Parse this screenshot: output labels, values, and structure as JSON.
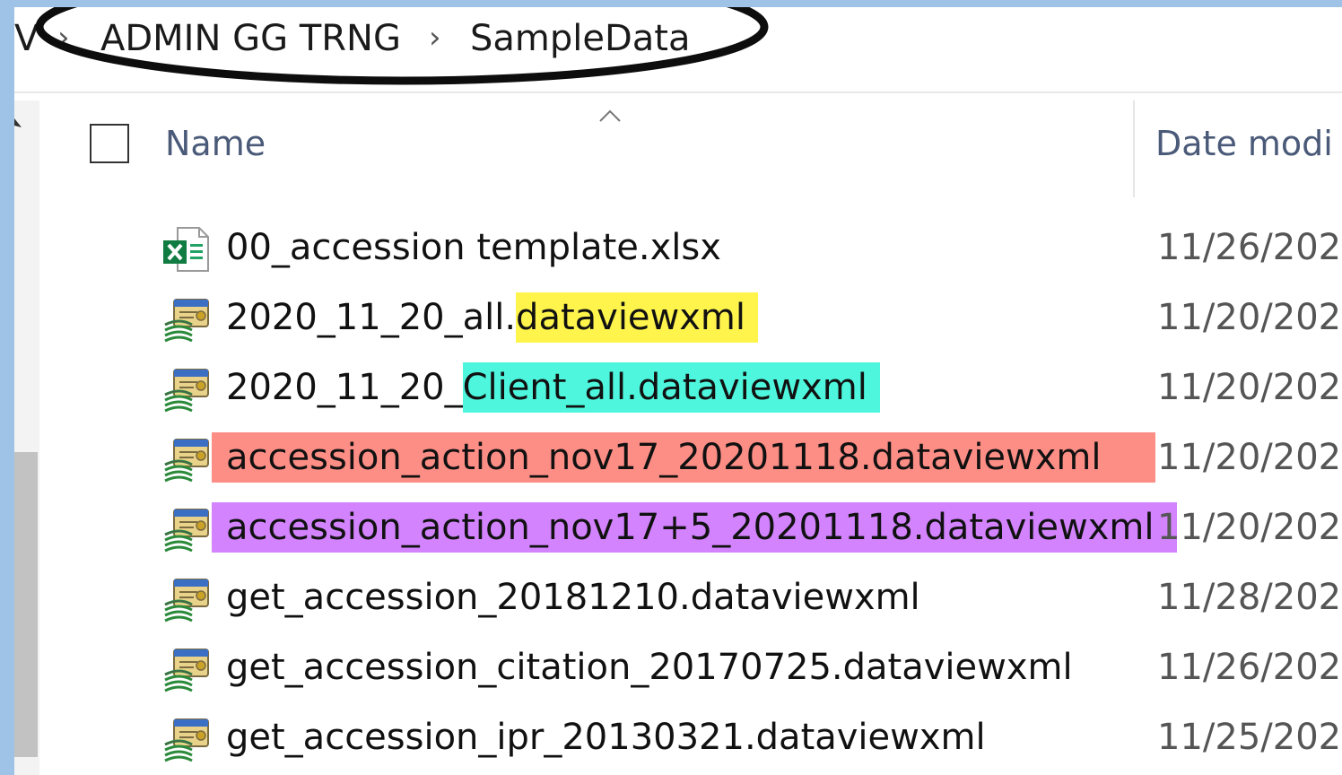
{
  "breadcrumb": {
    "partial_left": "V",
    "items": [
      "ADMIN GG TRNG",
      "SampleData"
    ]
  },
  "columns": {
    "name": "Name",
    "date_modified": "Date modi"
  },
  "highlight_colors": {
    "yellow": "#fef44c",
    "cyan": "#4df6dc",
    "salmon": "#fd8e86",
    "purple": "#d283fd"
  },
  "files": [
    {
      "icon": "excel-icon",
      "name_pre": "00_accession template.xlsx",
      "name_hl": "",
      "name_post": "",
      "highlight": "none",
      "date": "11/26/202"
    },
    {
      "icon": "dataview-xml-icon",
      "name_pre": "2020_11_20_all.",
      "name_hl": "dataviewxml",
      "name_post": "",
      "highlight": "yellow",
      "date": "11/20/202"
    },
    {
      "icon": "dataview-xml-icon",
      "name_pre": "2020_11_20_",
      "name_hl": "Client_all.dataviewxml",
      "name_post": "",
      "highlight": "cyan",
      "date": "11/20/202"
    },
    {
      "icon": "dataview-xml-icon",
      "name_pre": "",
      "name_hl": "accession_action_nov17_20201118.dataviewxml",
      "name_post": "",
      "highlight": "salmon",
      "date": "11/20/202"
    },
    {
      "icon": "dataview-xml-icon",
      "name_pre": "",
      "name_hl": "accession_action_nov17+5_20201118.dataviewxml",
      "name_post": "",
      "highlight": "purple",
      "date": "11/20/202"
    },
    {
      "icon": "dataview-xml-icon",
      "name_pre": "get_accession_20181210.dataviewxml",
      "name_hl": "",
      "name_post": "",
      "highlight": "none",
      "date": "11/28/202"
    },
    {
      "icon": "dataview-xml-icon",
      "name_pre": "get_accession_citation_20170725.dataviewxml",
      "name_hl": "",
      "name_post": "",
      "highlight": "none",
      "date": "11/26/202"
    },
    {
      "icon": "dataview-xml-icon",
      "name_pre": "get_accession_ipr_20130321.dataviewxml",
      "name_hl": "",
      "name_post": "",
      "highlight": "none",
      "date": "11/25/202"
    }
  ]
}
